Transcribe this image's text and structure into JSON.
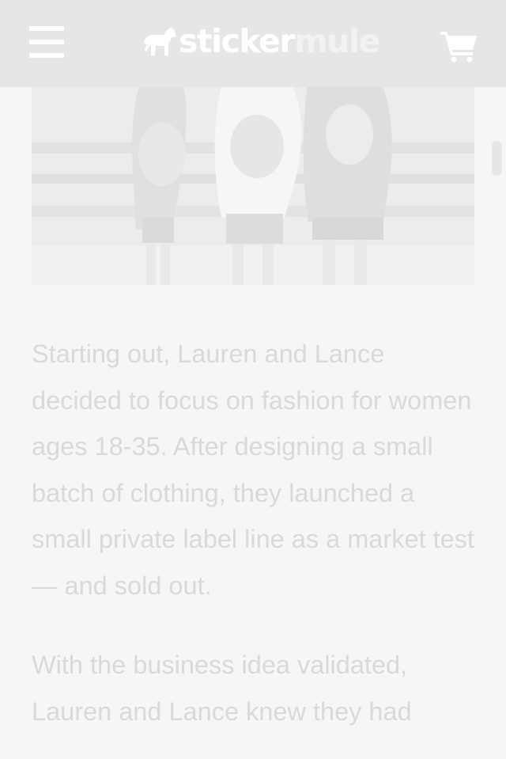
{
  "header": {
    "logo": {
      "word1": "sticker",
      "word2": "mule"
    },
    "icons": {
      "menu": "hamburger-menu-icon",
      "cart": "shopping-cart-icon",
      "logo_mark": "mule-icon"
    }
  },
  "article": {
    "paragraphs": [
      "Starting out, Lauren and Lance decided to focus on fashion for women ages 18-35. After designing a small batch of clothing, they launched a small private label line as a market test — and sold out.",
      "With the business idea validated, Lauren and Lance knew they had"
    ]
  },
  "colors": {
    "header_bg": "#e6e6e6",
    "page_bg": "#f6f6f6",
    "text": "#d9d9d9"
  }
}
